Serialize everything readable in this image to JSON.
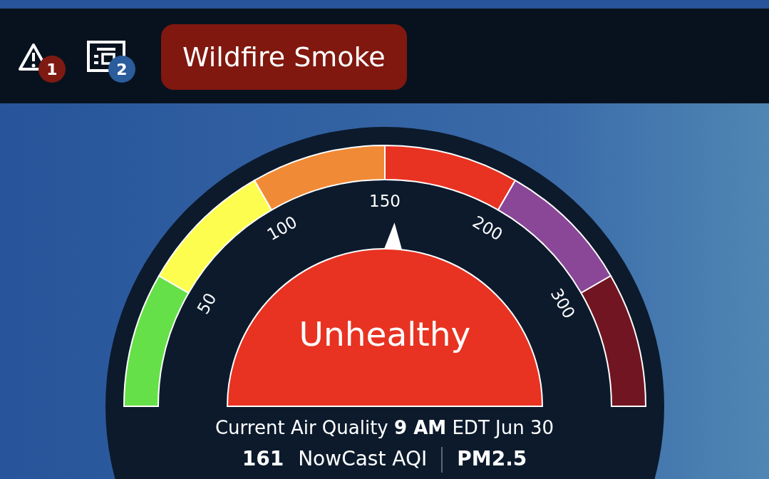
{
  "header": {
    "alerts": {
      "count": "1",
      "color": "#7f1a12"
    },
    "news": {
      "count": "2",
      "color": "#2b5c9c"
    },
    "tag": {
      "label": "Wildfire Smoke",
      "color": "#80180f"
    }
  },
  "gauge": {
    "segments": [
      {
        "color": "#66e048",
        "label": "50"
      },
      {
        "color": "#fdfd50",
        "label": "100"
      },
      {
        "color": "#f08a36",
        "label": "150"
      },
      {
        "color": "#e83322",
        "label": "200"
      },
      {
        "color": "#8a4797",
        "label": "300"
      },
      {
        "color": "#721522"
      }
    ],
    "category": {
      "label": "Unhealthy",
      "color": "#e83322"
    }
  },
  "current": "Current Air Quality **9 AM** EDT Jun 30",
  "reading": {
    "value": "161",
    "unit": "NowCast AQI",
    "pollutant": "PM2.5"
  }
}
